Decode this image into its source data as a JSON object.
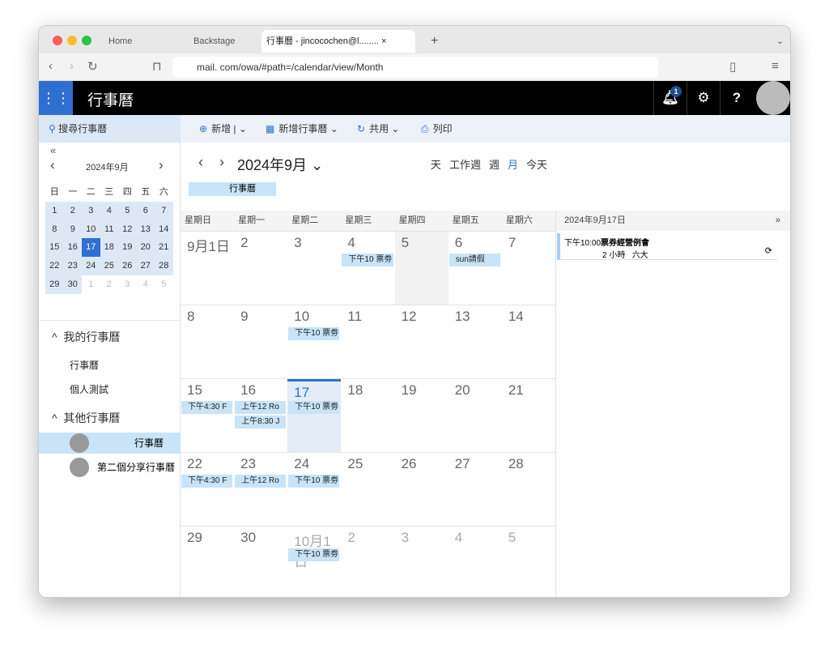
{
  "browser": {
    "tabs": [
      "Home",
      "Backstage",
      "行事曆 - jincocochen@l........"
    ],
    "url": "mail.        com/owa/#path=/calendar/view/Month"
  },
  "header": {
    "title": "行事曆",
    "notif_count": "1"
  },
  "toolbar": {
    "search": "搜尋行事曆",
    "new": "新增",
    "new_calendar": "新增行事曆",
    "share": "共用",
    "print": "列印"
  },
  "mini": {
    "collapse": "«",
    "title": "2024年9月",
    "weekdays": [
      "日",
      "一",
      "二",
      "三",
      "四",
      "五",
      "六"
    ],
    "days": [
      "1",
      "2",
      "3",
      "4",
      "5",
      "6",
      "7",
      "8",
      "9",
      "10",
      "11",
      "12",
      "13",
      "14",
      "15",
      "16",
      "17",
      "18",
      "19",
      "20",
      "21",
      "22",
      "23",
      "24",
      "25",
      "26",
      "27",
      "28",
      "29",
      "30",
      "1",
      "2",
      "3",
      "4",
      "5"
    ],
    "selected": "17"
  },
  "sidebar": {
    "my": "我的行事曆",
    "my_items": [
      "行事曆",
      "個人測試"
    ],
    "other": "其他行事曆",
    "other_items": [
      "行事曆",
      "第二個分享行事曆"
    ]
  },
  "main": {
    "title": "2024年9月",
    "calendar_tag": "行事曆",
    "views": [
      "天",
      "工作週",
      "週",
      "月",
      "今天"
    ],
    "active_view": "月",
    "weekdays": [
      "星期日",
      "星期一",
      "星期二",
      "星期三",
      "星期四",
      "星期五",
      "星期六"
    ],
    "weeks": [
      [
        {
          "n": "9月1日"
        },
        {
          "n": "2"
        },
        {
          "n": "3"
        },
        {
          "n": "4",
          "ev": [
            "下午10 票劵"
          ]
        },
        {
          "n": "5",
          "grey": true
        },
        {
          "n": "6",
          "ev": [
            "sun請假"
          ]
        },
        {
          "n": "7"
        }
      ],
      [
        {
          "n": "8"
        },
        {
          "n": "9"
        },
        {
          "n": "10",
          "ev": [
            "下午10 票劵"
          ]
        },
        {
          "n": "11"
        },
        {
          "n": "12"
        },
        {
          "n": "13"
        },
        {
          "n": "14"
        }
      ],
      [
        {
          "n": "15",
          "ev": [
            "下午4:30 F"
          ]
        },
        {
          "n": "16",
          "ev": [
            "上午12 Ro",
            "上午8:30 J"
          ]
        },
        {
          "n": "17",
          "today": true,
          "ev": [
            "下午10 票劵"
          ]
        },
        {
          "n": "18"
        },
        {
          "n": "19"
        },
        {
          "n": "20"
        },
        {
          "n": "21"
        }
      ],
      [
        {
          "n": "22",
          "ev": [
            "下午4:30 F"
          ]
        },
        {
          "n": "23",
          "ev": [
            "上午12 Ro"
          ]
        },
        {
          "n": "24",
          "ev": [
            "下午10 票劵"
          ]
        },
        {
          "n": "25"
        },
        {
          "n": "26"
        },
        {
          "n": "27"
        },
        {
          "n": "28"
        }
      ],
      [
        {
          "n": "29"
        },
        {
          "n": "30"
        },
        {
          "n": "10月1日",
          "other": true,
          "ev": [
            "下午10 票劵"
          ]
        },
        {
          "n": "2",
          "other": true
        },
        {
          "n": "3",
          "other": true
        },
        {
          "n": "4",
          "other": true
        },
        {
          "n": "5",
          "other": true
        }
      ]
    ]
  },
  "agenda": {
    "date": "2024年9月17日",
    "expand": "»",
    "time": "下午10:00",
    "title": "票券經營例會",
    "duration": "2 小時",
    "location": "六大"
  }
}
